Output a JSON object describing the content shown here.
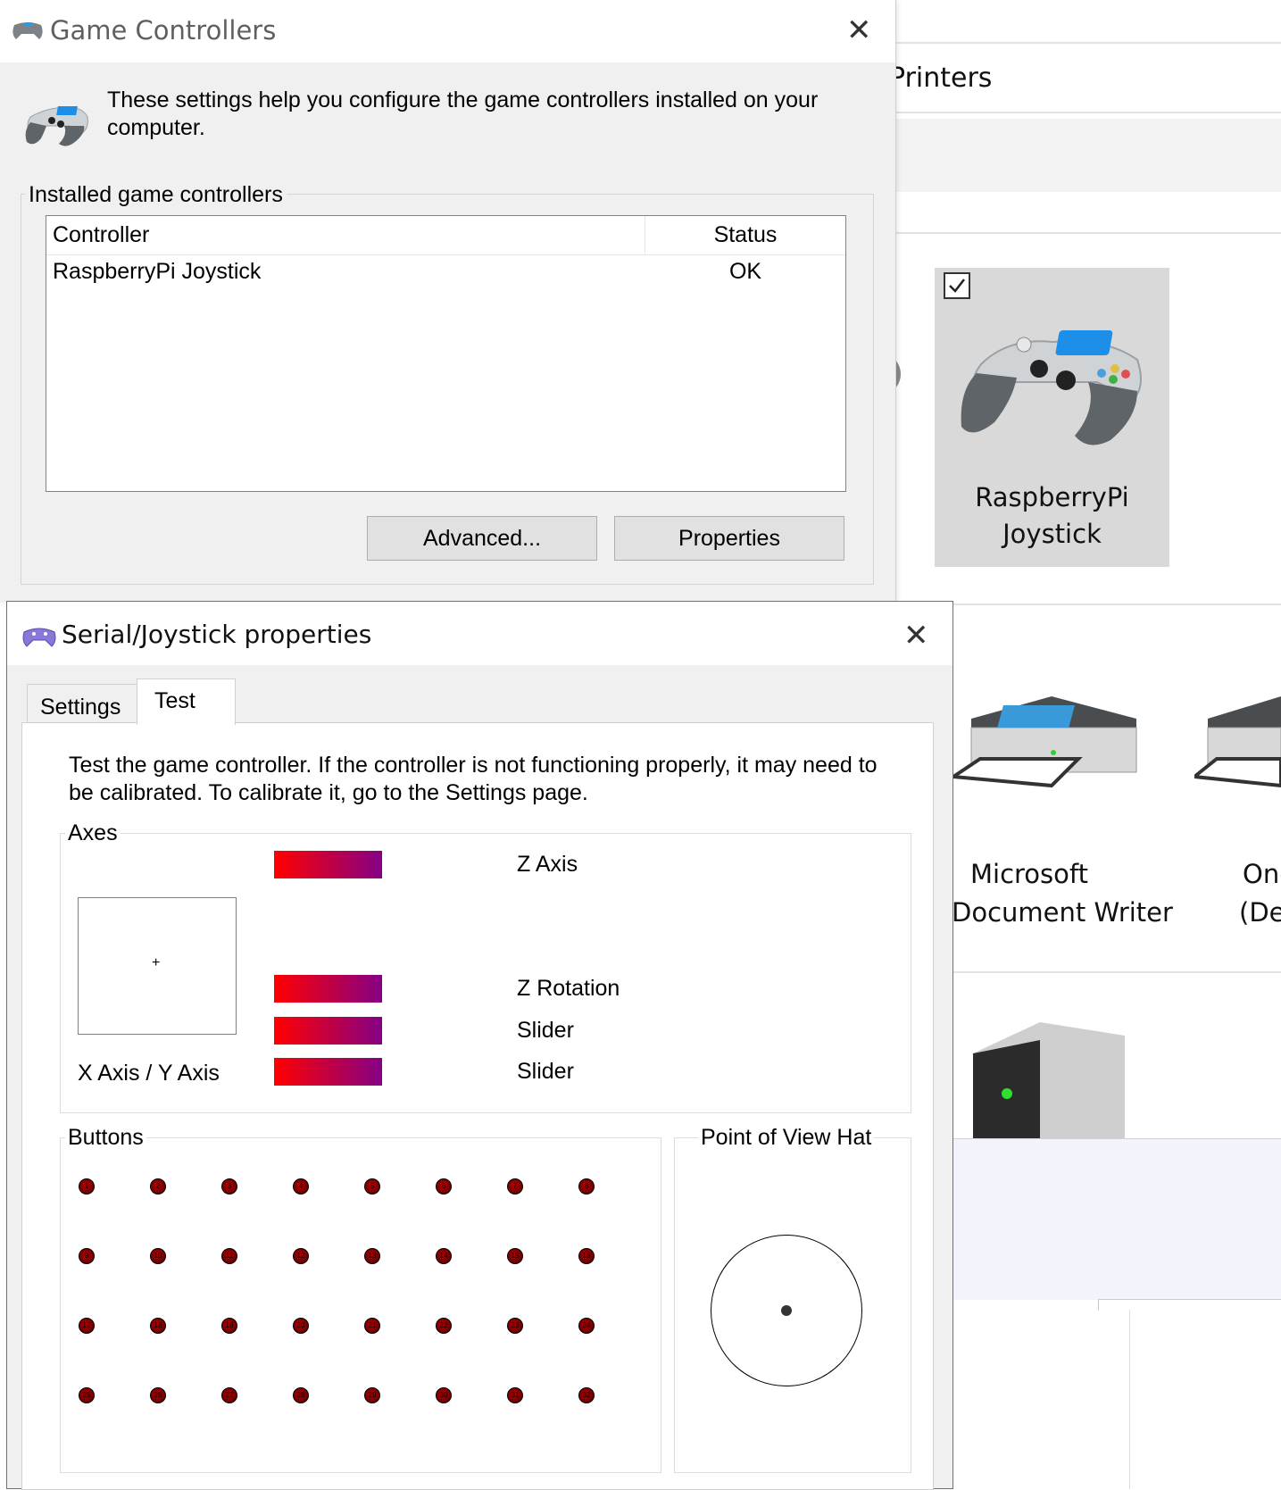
{
  "background_window": {
    "section_title": "Printers",
    "devices": [
      {
        "name_line1": "RaspberryPi",
        "name_line2": "Joystick",
        "selected": true
      },
      {
        "name_line1": "Microsoft",
        "name_line2": "Document Writer"
      },
      {
        "name_line1": "One",
        "name_line2": "(De"
      }
    ]
  },
  "game_controllers": {
    "title": "Game Controllers",
    "intro": "These settings help you configure the game controllers installed on your computer.",
    "group_label": "Installed game controllers",
    "columns": {
      "controller": "Controller",
      "status": "Status"
    },
    "rows": [
      {
        "controller": "RaspberryPi Joystick",
        "status": "OK"
      }
    ],
    "advanced_button": "Advanced...",
    "properties_button": "Properties"
  },
  "joystick_properties": {
    "title": "Serial/Joystick properties",
    "tabs": {
      "settings": "Settings",
      "test": "Test"
    },
    "active_tab": "Test",
    "intro": "Test the game controller.  If the controller is not functioning properly, it may need to be calibrated.  To calibrate it, go to the Settings page.",
    "axes": {
      "group_label": "Axes",
      "xy_label": "X Axis / Y Axis",
      "z_axis": "Z Axis",
      "z_rotation": "Z Rotation",
      "slider_1": "Slider",
      "slider_2": "Slider"
    },
    "buttons": {
      "group_label": "Buttons",
      "count": 32
    },
    "pov": {
      "group_label": "Point of View Hat"
    }
  },
  "colors": {
    "axis_bar_start": "#ff0000",
    "axis_bar_end": "#850085",
    "button_off": "#7a0000",
    "tile_selected": "#d9d9d9",
    "dialog_bg": "#f0f0f0"
  }
}
